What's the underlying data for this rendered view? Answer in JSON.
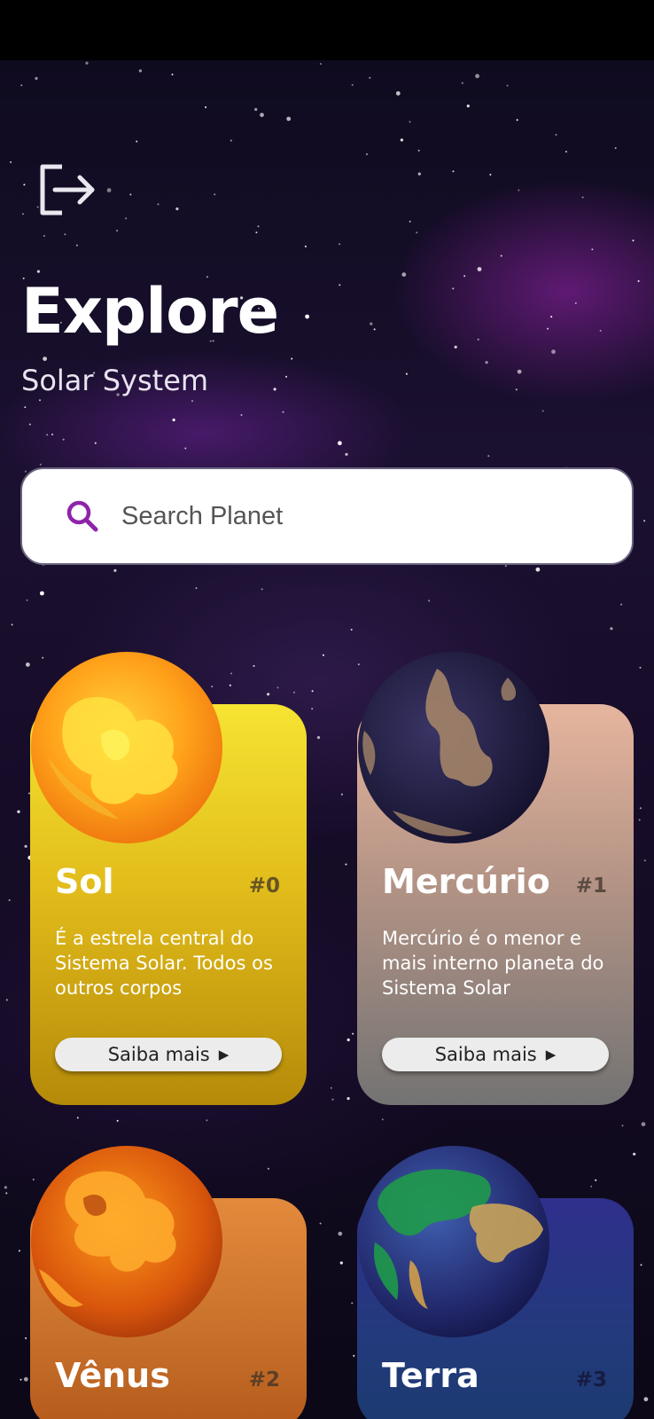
{
  "header": {
    "title": "Explore",
    "subtitle": "Solar System"
  },
  "search": {
    "placeholder": "Search Planet",
    "value": ""
  },
  "cards": [
    {
      "name": "Sol",
      "number": "#0",
      "description": "É a estrela central do Sistema Solar. Todos os outros corpos",
      "button_label": "Saiba mais",
      "color_top": "#f6e432",
      "color_bottom": "#b58a09"
    },
    {
      "name": "Mercúrio",
      "number": "#1",
      "description": "Mercúrio é o menor e mais interno planeta do Sistema Solar",
      "button_label": "Saiba mais",
      "color_top": "#e6b59e",
      "color_bottom": "#737373"
    },
    {
      "name": "Vênus",
      "number": "#2",
      "description": "",
      "button_label": "",
      "color_top": "#e38a3c",
      "color_bottom": "#b45a1c"
    },
    {
      "name": "Terra",
      "number": "#3",
      "description": "",
      "button_label": "",
      "color_top": "#2f2f8c",
      "color_bottom": "#1c3a70"
    }
  ],
  "icons": {
    "logout": "logout-icon",
    "search": "search-icon",
    "arrow": "play-arrow-icon"
  },
  "colors": {
    "accent": "#8e24aa",
    "background": "#150b26"
  }
}
